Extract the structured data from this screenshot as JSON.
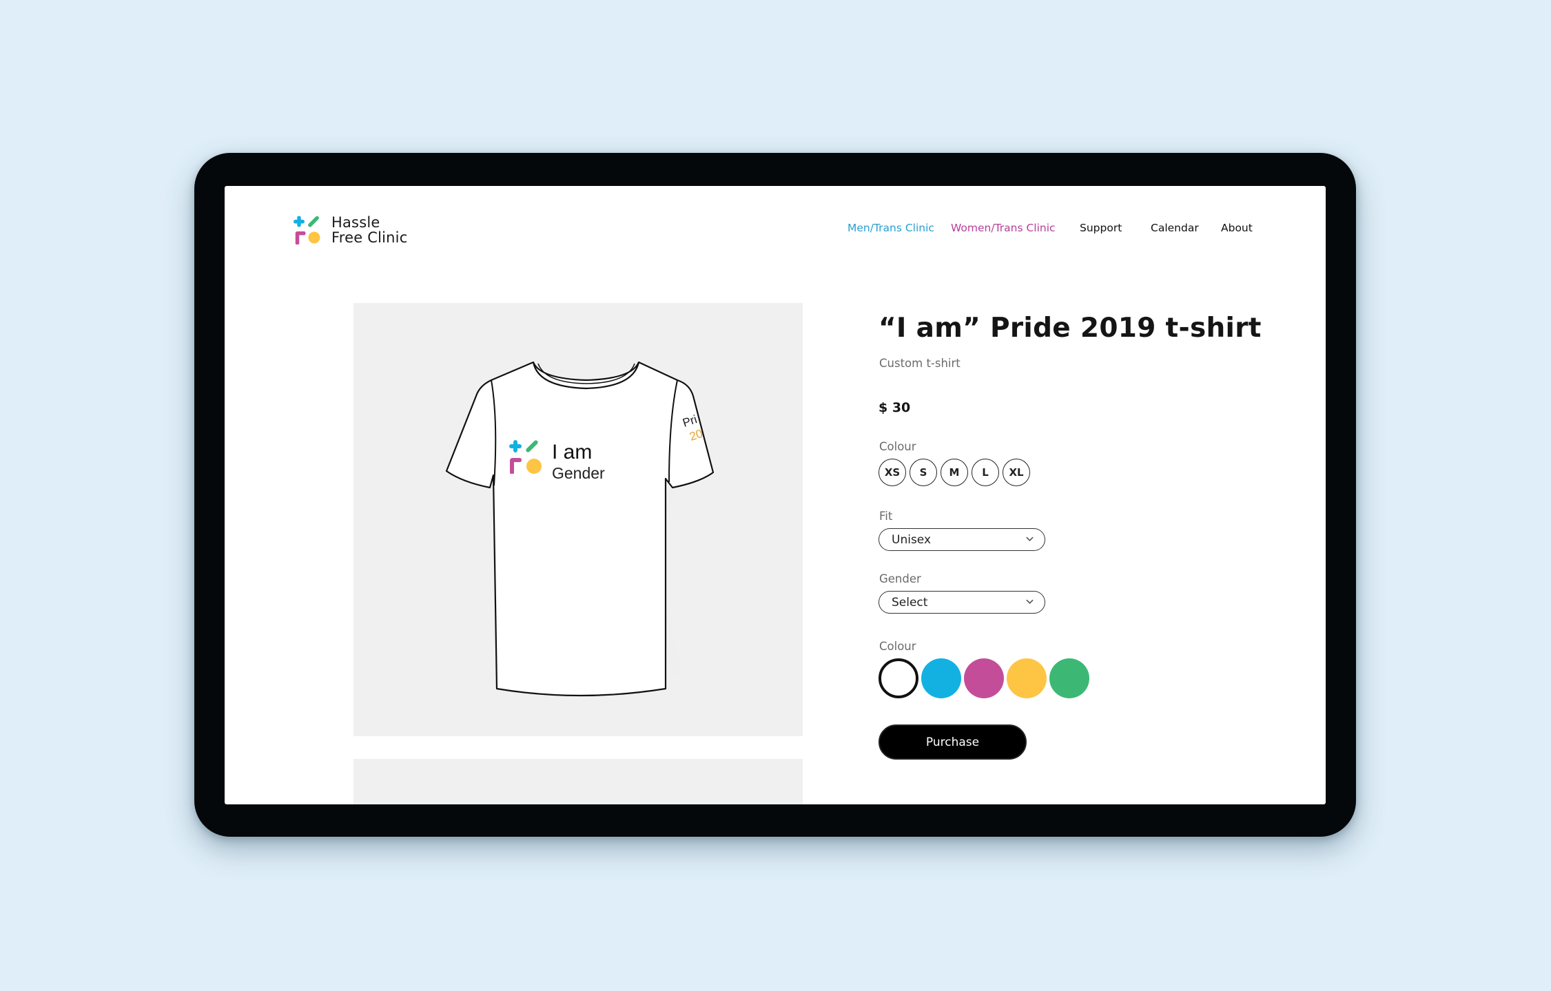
{
  "brand": {
    "name_line1": "Hassle",
    "name_line2": "Free Clinic",
    "colors": {
      "blue": "#12b1e2",
      "green": "#3db874",
      "magenta": "#c44d99",
      "yellow": "#fdc543"
    }
  },
  "nav": {
    "items": [
      {
        "label": "Men/Trans Clinic",
        "color": "#2a9fd0"
      },
      {
        "label": "Women/Trans Clinic",
        "color": "#b6409a"
      },
      {
        "label": "Support"
      },
      {
        "label": "Calendar"
      },
      {
        "label": "About"
      }
    ]
  },
  "product_image": {
    "print_line1": "I am",
    "print_line2": "Gender",
    "sleeve_line1": "Pri",
    "sleeve_line2": "20"
  },
  "product": {
    "title": "“I am” Pride 2019 t-shirt",
    "subtitle": "Custom t-shirt",
    "price": "$ 30",
    "size_label": "Colour",
    "sizes": [
      "XS",
      "S",
      "M",
      "L",
      "XL"
    ],
    "fit_label": "Fit",
    "fit_value": "Unisex",
    "gender_label": "Gender",
    "gender_value": "Select",
    "colour_label": "Colour",
    "colours": [
      {
        "name": "white",
        "hex": "#ffffff",
        "selected": true
      },
      {
        "name": "blue",
        "hex": "#12b1e2"
      },
      {
        "name": "magenta",
        "hex": "#c44d99"
      },
      {
        "name": "yellow",
        "hex": "#fdc543"
      },
      {
        "name": "green",
        "hex": "#3db874"
      }
    ],
    "purchase_label": "Purchase"
  }
}
